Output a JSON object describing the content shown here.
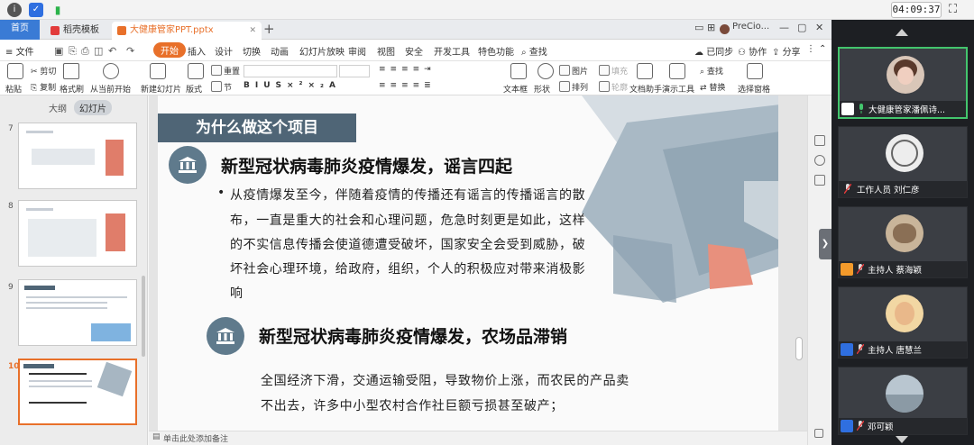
{
  "system": {
    "clock": "04:09:37"
  },
  "tabs": {
    "home": "首页",
    "templates": "稻壳模板",
    "document": "大健康管家PPT.pptx",
    "user": "PreCio..."
  },
  "menu": {
    "file": "文件",
    "items": [
      "开始",
      "插入",
      "设计",
      "切换",
      "动画",
      "幻灯片放映",
      "审阅",
      "视图",
      "安全",
      "开发工具",
      "特色功能"
    ],
    "search": "查找",
    "sync": "已同步",
    "collab": "协作",
    "share": "分享"
  },
  "toolbar": {
    "paste": "粘贴",
    "cut": "剪切",
    "copy": "复制",
    "format_painter": "格式刷",
    "play_current": "从当前开始",
    "new_slide": "新建幻灯片",
    "layout": "版式",
    "reset": "重置",
    "section": "节",
    "textbox": "文本框",
    "shape": "形状",
    "picture": "图片",
    "arrange": "排列",
    "fill": "填充",
    "outline": "轮廓",
    "doc_assistant": "文档助手",
    "presenter_tools": "演示工具",
    "find": "查找",
    "replace": "替换",
    "select_pane": "选择窗格"
  },
  "panel": {
    "tab_outline": "大纲",
    "tab_slides": "幻灯片",
    "slide_numbers": [
      "7",
      "8",
      "9",
      "10"
    ],
    "active_slide": "10"
  },
  "slide": {
    "title": "为什么做这个项目",
    "heading1": "新型冠状病毒肺炎疫情爆发，谣言四起",
    "bullet": "•",
    "para1": [
      "从疫情爆发至今，伴随着疫情的传播还有谣言的传播谣言的散",
      "布，一直是重大的社会和心理问题，危急时刻更是如此，这样",
      "的不实信息传播会使道德遭受破坏，国家安全会受到威胁，破",
      "坏社会心理环境，给政府，组织，个人的积极应对带来消极影",
      "响"
    ],
    "heading2": "新型冠状病毒肺炎疫情爆发，农场品滞销",
    "para2": [
      "全国经济下滑，交通运输受阻，导致物价上涨，而农民的产品卖",
      "不出去，许多中小型农村合作社巨额亏损甚至破产；"
    ],
    "colors": {
      "title_bar": "#4f6576",
      "icon_circle": "#5f7a8c",
      "deco_blue": "#8fa3b1",
      "deco_salmon": "#e8907d",
      "accent": "#e8702a"
    }
  },
  "notes": {
    "placeholder": "单击此处添加备注"
  },
  "participants": [
    {
      "name": "大健康管家潘佩诗...",
      "role": "presenter",
      "active": true
    },
    {
      "name": "工作人员 刘仁彦",
      "role": "staff",
      "active": false
    },
    {
      "name": "主持人 蔡海颖",
      "role": "host",
      "active": false
    },
    {
      "name": "主持人 唐慧兰",
      "role": "host",
      "active": false
    },
    {
      "name": "邓可颖",
      "role": "member",
      "active": false
    }
  ]
}
